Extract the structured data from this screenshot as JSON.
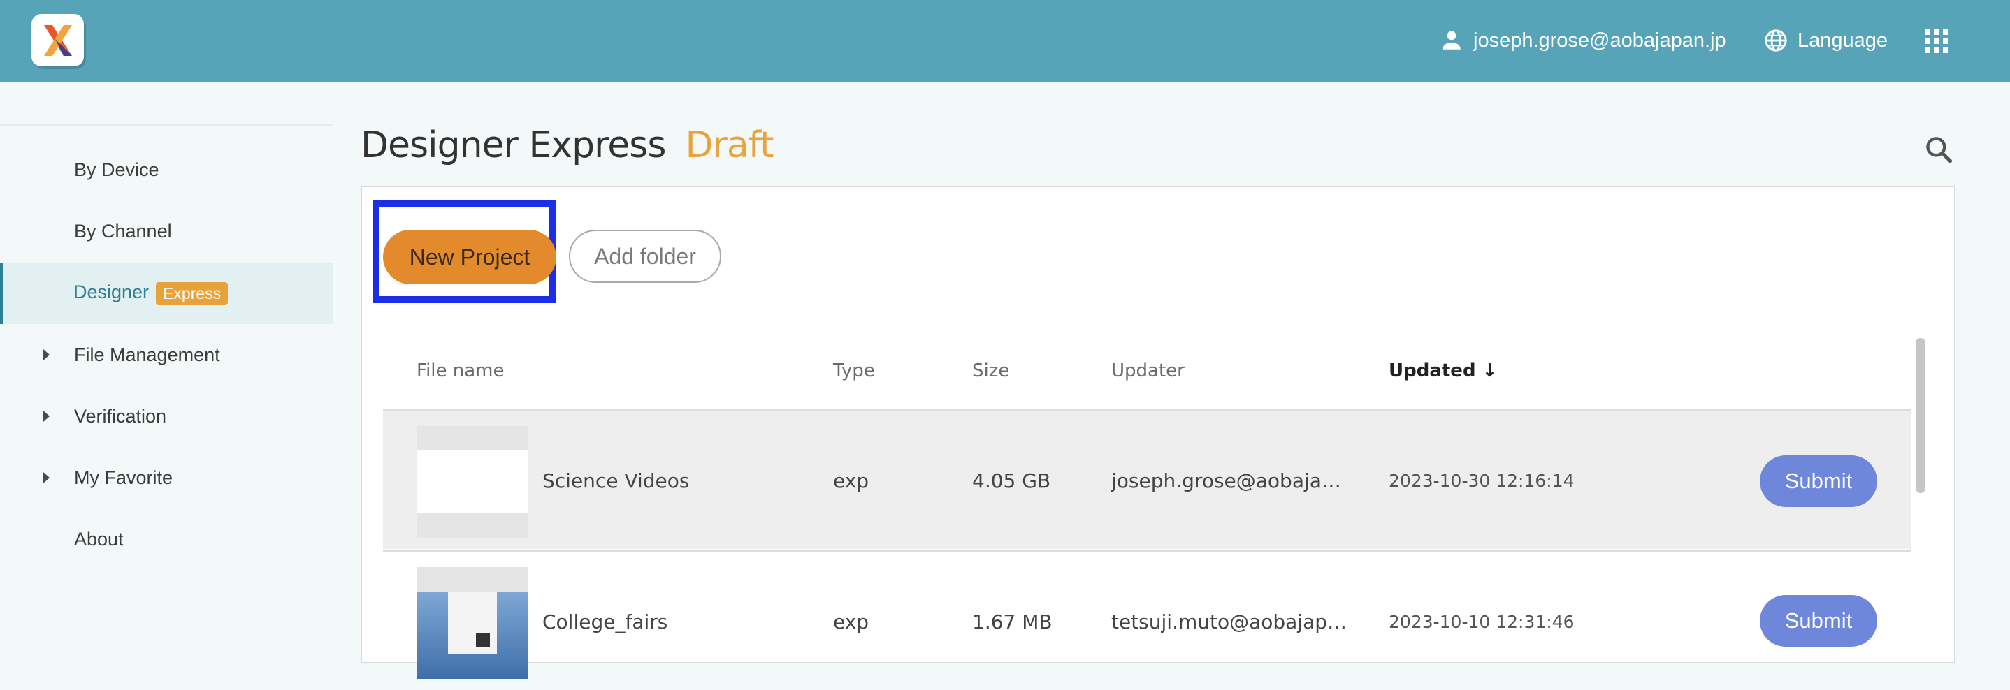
{
  "header": {
    "user_email": "joseph.grose@aobajapan.jp",
    "language_label": "Language"
  },
  "sidebar": {
    "items": [
      {
        "label": "By Device"
      },
      {
        "label": "By Channel"
      },
      {
        "label": "Designer",
        "badge": "Express"
      },
      {
        "label": "File Management"
      },
      {
        "label": "Verification"
      },
      {
        "label": "My Favorite"
      },
      {
        "label": "About"
      }
    ]
  },
  "main": {
    "title": "Designer Express",
    "title_status": "Draft",
    "new_project_label": "New Project",
    "add_folder_label": "Add folder",
    "columns": [
      "File name",
      "Type",
      "Size",
      "Updater",
      "Updated"
    ],
    "sort_indicator": "↓",
    "rows": [
      {
        "name": "Science Videos",
        "type": "exp",
        "size": "4.05 GB",
        "updater": "joseph.grose@aobaja…",
        "updated": "2023-10-30 12:16:14",
        "action": "Submit"
      },
      {
        "name": "College_fairs",
        "type": "exp",
        "size": "1.67 MB",
        "updater": "tetsuji.muto@aobajap…",
        "updated": "2023-10-10 12:31:46",
        "action": "Submit"
      }
    ]
  },
  "colors": {
    "header_bg": "#57a3b8",
    "accent_orange": "#e28a2c",
    "draft_color": "#e9a33a",
    "submit_bg": "#6f87db",
    "focus_outline": "#1d2ee8",
    "active_nav": "#2f7f95"
  }
}
